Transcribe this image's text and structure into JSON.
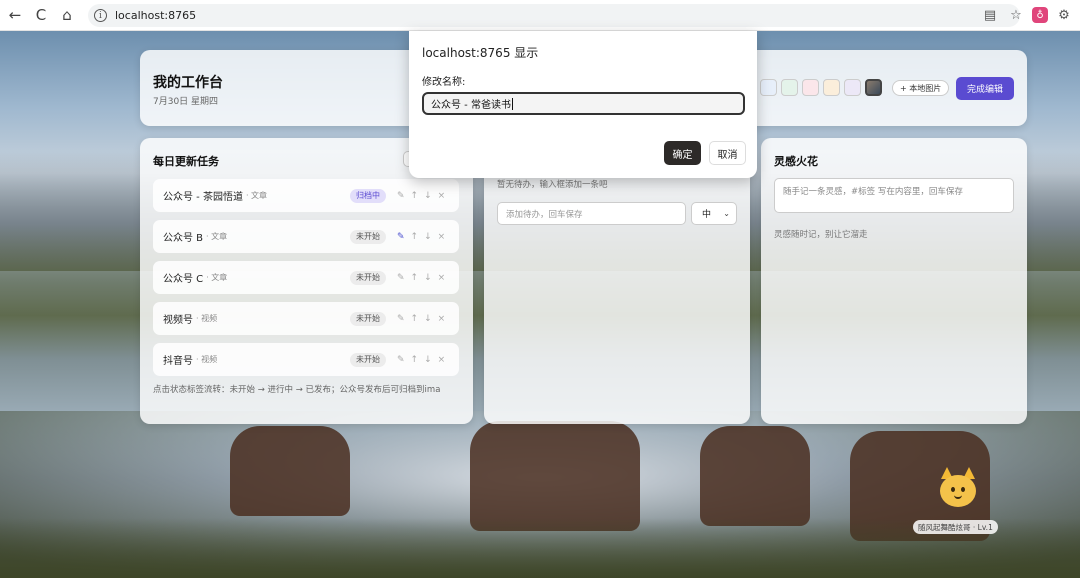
{
  "browser": {
    "url": "localhost:8765",
    "back_icon": "←",
    "reload_icon": "C",
    "home_icon": "⌂",
    "info_icon": "i"
  },
  "header": {
    "title": "我的工作台",
    "date": "7月30日 星期四",
    "local_image_label": "+ 本地图片",
    "done_label": "完成编辑",
    "swatch_colors": [
      "#e7effa",
      "#e4f3ea",
      "#fbe6ea",
      "#fbeedb",
      "#ece8f7"
    ]
  },
  "tasks": {
    "title": "每日更新任务",
    "rows": [
      {
        "name": "公众号 - 茶园悟道",
        "type": "· 文章",
        "status": "归档中",
        "archived": true
      },
      {
        "name": "公众号 B",
        "type": "· 文章",
        "status": "未开始",
        "archived": false
      },
      {
        "name": "公众号 C",
        "type": "· 文章",
        "status": "未开始",
        "archived": false
      },
      {
        "name": "视频号",
        "type": "· 视频",
        "status": "未开始",
        "archived": false
      },
      {
        "name": "抖音号",
        "type": "· 视频",
        "status": "未开始",
        "archived": false
      }
    ],
    "hint": "点击状态标签流转：未开始 → 进行中 → 已发布；公众号发布后可归档到ima"
  },
  "todo": {
    "empty_text": "暂无待办，输入框添加一条吧",
    "input_placeholder": "添加待办，回车保存",
    "priority_value": "中"
  },
  "ideas": {
    "title": "灵感火花",
    "input_placeholder": "随手记一条灵感，#标签 写在内容里，回车保存",
    "hint": "灵感随时记，别让它溜走"
  },
  "mascot": {
    "label": "随风起舞酷炫哥 · Lv.1"
  },
  "dialog": {
    "title": "localhost:8765 显示",
    "label": "修改名称:",
    "value": "公众号 - 常爸读书",
    "ok": "确定",
    "cancel": "取消"
  }
}
